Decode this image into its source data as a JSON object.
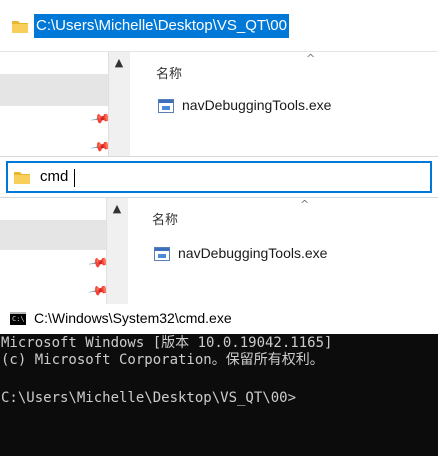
{
  "explorer_top": {
    "address_path": "C:\\Users\\Michelle\\Desktop\\VS_QT\\00",
    "column_header": "名称",
    "file_name": "navDebuggingTools.exe"
  },
  "explorer_bottom": {
    "address_input": "cmd",
    "column_header": "名称",
    "file_name": "navDebuggingTools.exe"
  },
  "console": {
    "title": "C:\\Windows\\System32\\cmd.exe",
    "lines": [
      "Microsoft Windows [版本 10.0.19042.1165]",
      "(c) Microsoft Corporation。保留所有权利。",
      "",
      "C:\\Users\\Michelle\\Desktop\\VS_QT\\00>"
    ]
  },
  "colors": {
    "selection": "#0078d7",
    "console_bg": "#0c0c0c",
    "console_fg": "#cccccc"
  }
}
